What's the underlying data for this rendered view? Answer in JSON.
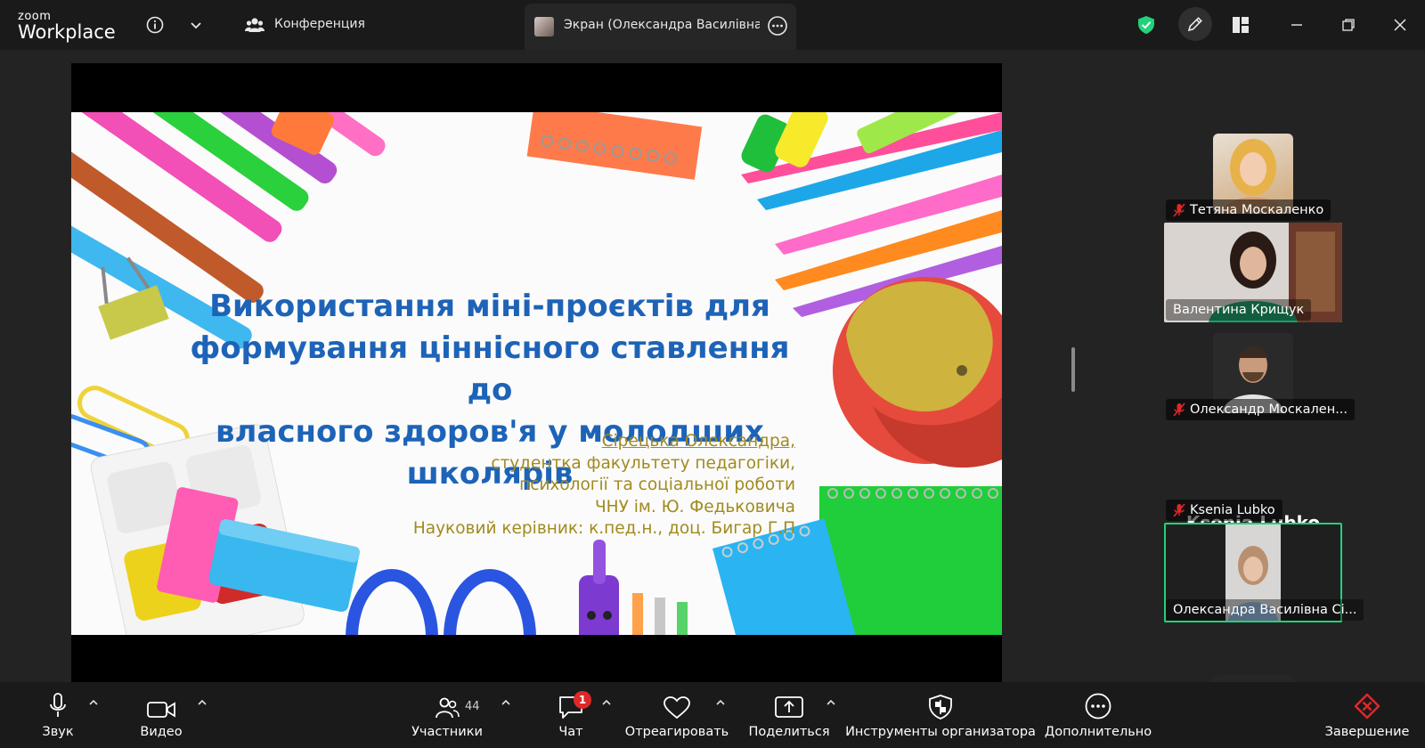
{
  "brand": {
    "small": "zoom",
    "big": "Workplace"
  },
  "topbar": {
    "conference_label": "Конференция",
    "screen_tab_label": "Экран (Олександра Василівна Сірецька)"
  },
  "slide": {
    "title_lines": [
      "Використання міні-проєктів для",
      "формування ціннісного ставлення до",
      "власного здоров'я у молодших школярів"
    ],
    "author": "Сірецька Олександра,",
    "info_lines": [
      "студентка факультету педагогіки,",
      "психології та соціальної роботи",
      "ЧНУ ім. Ю. Федьковича",
      "Науковий керівник: к.пед.н., доц. Бигар Г.П"
    ]
  },
  "participants": [
    {
      "name": "Тетяна Москаленко",
      "muted": true
    },
    {
      "name": "Валентина Крищук",
      "muted": false
    },
    {
      "name": "Олександр Москален...",
      "muted": true
    },
    {
      "name": "Ksenia Lubko",
      "muted": true,
      "display_name": "Ksenia Lubko"
    },
    {
      "name": "Олександра Василівна Сі...",
      "muted": false,
      "active": true
    }
  ],
  "toolbar": {
    "audio": "Звук",
    "video": "Видео",
    "participants": "Участники",
    "participants_count": "44",
    "chat": "Чат",
    "chat_badge": "1",
    "react": "Отреагировать",
    "share": "Поделиться",
    "host_tools": "Инструменты организатора",
    "more": "Дополнительно",
    "end": "Завершение"
  },
  "colors": {
    "accent_green": "#22d27a",
    "title_blue": "#1d63b7",
    "subtitle_gold": "#a18a1d",
    "end_red": "#e02828"
  }
}
